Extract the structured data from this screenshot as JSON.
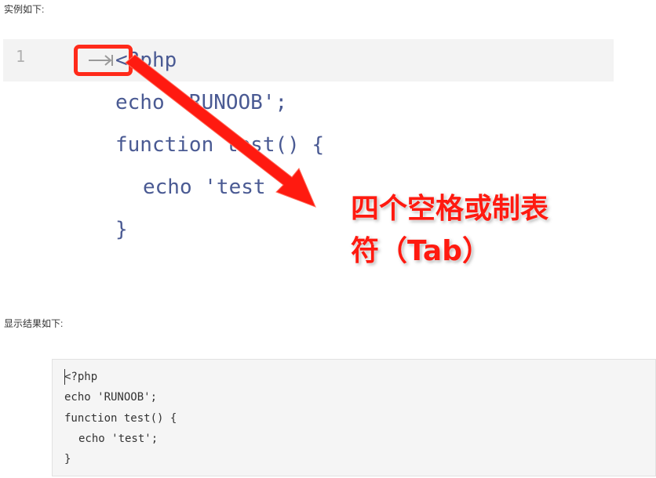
{
  "captions": {
    "example": "实例如下:",
    "result": "显示结果如下:"
  },
  "editor": {
    "line_number": "1",
    "lines": [
      "<?php",
      "echo 'RUNOOB';",
      "function test() {",
      "echo 'test",
      "}"
    ],
    "tab_glyph_icon": "tab-arrow-icon"
  },
  "annotation": {
    "line1": "四个空格或制表",
    "line2": "符（Tab）",
    "color": "#ff1a10"
  },
  "result": {
    "lines": [
      "<?php",
      "echo 'RUNOOB';",
      "function test() {",
      "echo 'test';",
      "}"
    ]
  }
}
